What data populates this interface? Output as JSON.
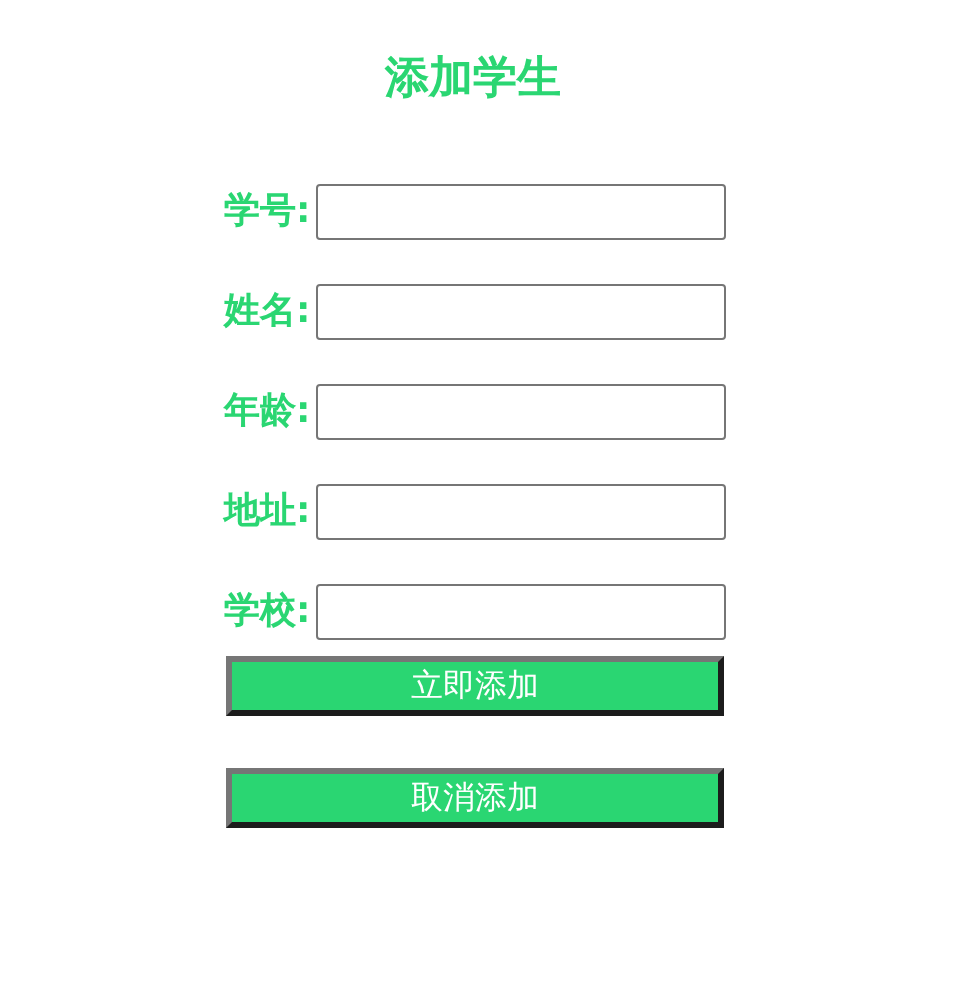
{
  "title": "添加学生",
  "fields": [
    {
      "label": "学号:"
    },
    {
      "label": "姓名:"
    },
    {
      "label": "年龄:"
    },
    {
      "label": "地址:"
    },
    {
      "label": "学校:"
    }
  ],
  "buttons": [
    "立即添加",
    "取消添加"
  ]
}
